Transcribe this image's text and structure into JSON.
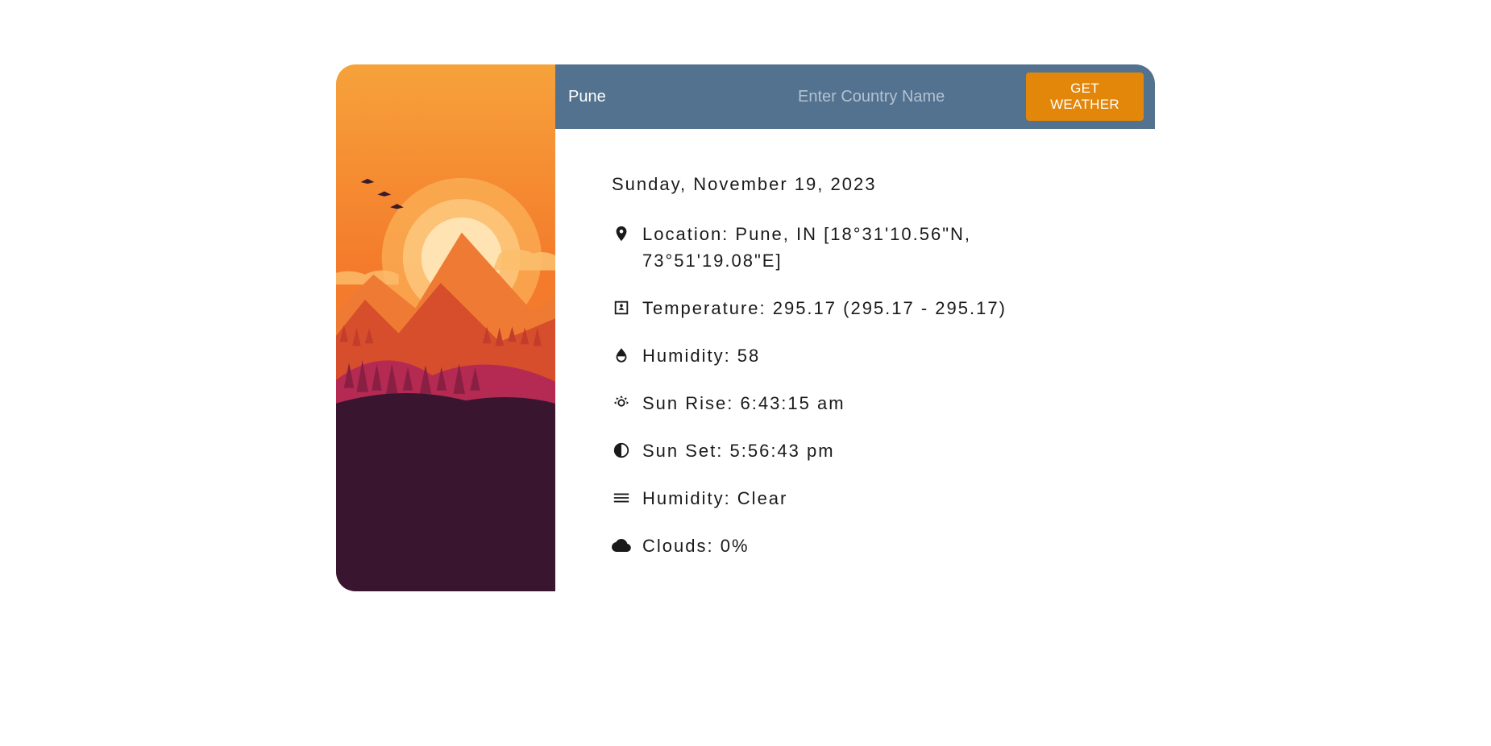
{
  "search": {
    "city_value": "Pune",
    "country_placeholder": "Enter Country Name",
    "button_label": "GET WEATHER"
  },
  "weather": {
    "date": "Sunday, November 19, 2023",
    "location": "Location: Pune, IN [18°31'10.56\"N, 73°51'19.08\"E]",
    "temperature": "Temperature: 295.17 (295.17 - 295.17)",
    "humidity": "Humidity: 58",
    "sunrise": "Sun Rise: 6:43:15 am",
    "sunset": "Sun Set: 5:56:43 pm",
    "condition": "Humidity: Clear",
    "clouds": "Clouds: 0%"
  }
}
